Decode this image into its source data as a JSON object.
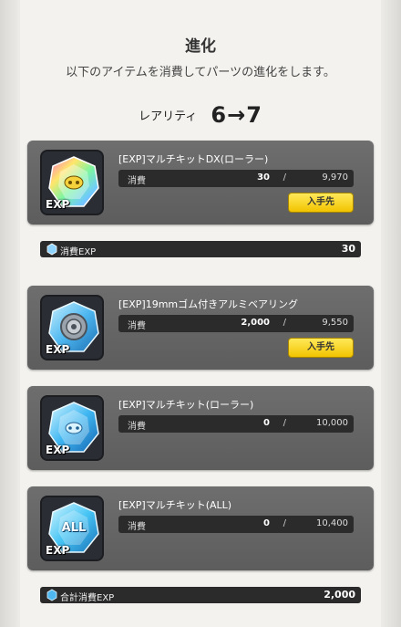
{
  "header": {
    "title": "進化",
    "subtitle": "以下のアイテムを消費してパーツの進化をします。",
    "rarity_label": "レアリティ",
    "rarity_value": "6→7"
  },
  "items": [
    {
      "name": "[EXP]マルチキットDX(ローラー)",
      "consume_label": "消費",
      "used": "30",
      "sep": "/",
      "owned": "9,970",
      "get_button": "入手先",
      "icon": "rainbow-crystal-icon",
      "exp_tag": "EXP"
    },
    {
      "name": "[EXP]19mmゴム付きアルミベアリング",
      "consume_label": "消費",
      "used": "2,000",
      "sep": "/",
      "owned": "9,550",
      "get_button": "入手先",
      "icon": "bearing-crystal-icon",
      "exp_tag": "EXP"
    },
    {
      "name": "[EXP]マルチキット(ローラー)",
      "consume_label": "消費",
      "used": "0",
      "sep": "/",
      "owned": "10,000",
      "icon": "blue-crystal-icon",
      "exp_tag": "EXP"
    },
    {
      "name": "[EXP]マルチキット(ALL)",
      "consume_label": "消費",
      "used": "0",
      "sep": "/",
      "owned": "10,400",
      "icon": "all-crystal-icon",
      "exp_tag": "EXP",
      "badge": "ALL"
    }
  ],
  "summary": {
    "consume_exp_label": "消費EXP",
    "consume_exp_value": "30",
    "total_label": "合計消費EXP",
    "total_value": "2,000"
  },
  "colors": {
    "card": "#666666",
    "bar": "#2b2b2b",
    "button": "#f2c400"
  }
}
